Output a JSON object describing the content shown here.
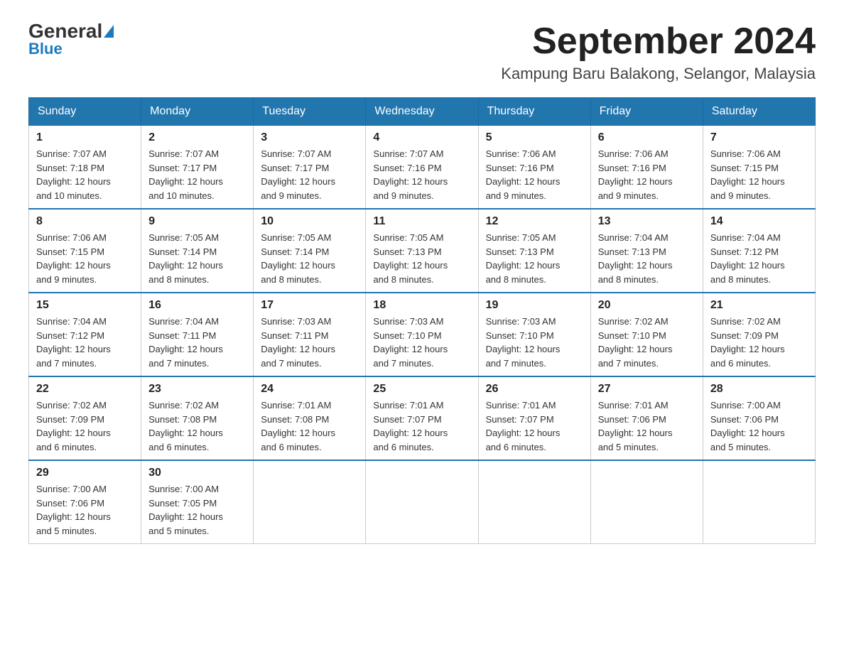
{
  "header": {
    "logo_general": "General",
    "logo_blue": "Blue",
    "month_title": "September 2024",
    "location": "Kampung Baru Balakong, Selangor, Malaysia"
  },
  "weekdays": [
    "Sunday",
    "Monday",
    "Tuesday",
    "Wednesday",
    "Thursday",
    "Friday",
    "Saturday"
  ],
  "weeks": [
    [
      {
        "day": "1",
        "sunrise": "7:07 AM",
        "sunset": "7:18 PM",
        "daylight": "12 hours and 10 minutes."
      },
      {
        "day": "2",
        "sunrise": "7:07 AM",
        "sunset": "7:17 PM",
        "daylight": "12 hours and 10 minutes."
      },
      {
        "day": "3",
        "sunrise": "7:07 AM",
        "sunset": "7:17 PM",
        "daylight": "12 hours and 9 minutes."
      },
      {
        "day": "4",
        "sunrise": "7:07 AM",
        "sunset": "7:16 PM",
        "daylight": "12 hours and 9 minutes."
      },
      {
        "day": "5",
        "sunrise": "7:06 AM",
        "sunset": "7:16 PM",
        "daylight": "12 hours and 9 minutes."
      },
      {
        "day": "6",
        "sunrise": "7:06 AM",
        "sunset": "7:16 PM",
        "daylight": "12 hours and 9 minutes."
      },
      {
        "day": "7",
        "sunrise": "7:06 AM",
        "sunset": "7:15 PM",
        "daylight": "12 hours and 9 minutes."
      }
    ],
    [
      {
        "day": "8",
        "sunrise": "7:06 AM",
        "sunset": "7:15 PM",
        "daylight": "12 hours and 9 minutes."
      },
      {
        "day": "9",
        "sunrise": "7:05 AM",
        "sunset": "7:14 PM",
        "daylight": "12 hours and 8 minutes."
      },
      {
        "day": "10",
        "sunrise": "7:05 AM",
        "sunset": "7:14 PM",
        "daylight": "12 hours and 8 minutes."
      },
      {
        "day": "11",
        "sunrise": "7:05 AM",
        "sunset": "7:13 PM",
        "daylight": "12 hours and 8 minutes."
      },
      {
        "day": "12",
        "sunrise": "7:05 AM",
        "sunset": "7:13 PM",
        "daylight": "12 hours and 8 minutes."
      },
      {
        "day": "13",
        "sunrise": "7:04 AM",
        "sunset": "7:13 PM",
        "daylight": "12 hours and 8 minutes."
      },
      {
        "day": "14",
        "sunrise": "7:04 AM",
        "sunset": "7:12 PM",
        "daylight": "12 hours and 8 minutes."
      }
    ],
    [
      {
        "day": "15",
        "sunrise": "7:04 AM",
        "sunset": "7:12 PM",
        "daylight": "12 hours and 7 minutes."
      },
      {
        "day": "16",
        "sunrise": "7:04 AM",
        "sunset": "7:11 PM",
        "daylight": "12 hours and 7 minutes."
      },
      {
        "day": "17",
        "sunrise": "7:03 AM",
        "sunset": "7:11 PM",
        "daylight": "12 hours and 7 minutes."
      },
      {
        "day": "18",
        "sunrise": "7:03 AM",
        "sunset": "7:10 PM",
        "daylight": "12 hours and 7 minutes."
      },
      {
        "day": "19",
        "sunrise": "7:03 AM",
        "sunset": "7:10 PM",
        "daylight": "12 hours and 7 minutes."
      },
      {
        "day": "20",
        "sunrise": "7:02 AM",
        "sunset": "7:10 PM",
        "daylight": "12 hours and 7 minutes."
      },
      {
        "day": "21",
        "sunrise": "7:02 AM",
        "sunset": "7:09 PM",
        "daylight": "12 hours and 6 minutes."
      }
    ],
    [
      {
        "day": "22",
        "sunrise": "7:02 AM",
        "sunset": "7:09 PM",
        "daylight": "12 hours and 6 minutes."
      },
      {
        "day": "23",
        "sunrise": "7:02 AM",
        "sunset": "7:08 PM",
        "daylight": "12 hours and 6 minutes."
      },
      {
        "day": "24",
        "sunrise": "7:01 AM",
        "sunset": "7:08 PM",
        "daylight": "12 hours and 6 minutes."
      },
      {
        "day": "25",
        "sunrise": "7:01 AM",
        "sunset": "7:07 PM",
        "daylight": "12 hours and 6 minutes."
      },
      {
        "day": "26",
        "sunrise": "7:01 AM",
        "sunset": "7:07 PM",
        "daylight": "12 hours and 6 minutes."
      },
      {
        "day": "27",
        "sunrise": "7:01 AM",
        "sunset": "7:06 PM",
        "daylight": "12 hours and 5 minutes."
      },
      {
        "day": "28",
        "sunrise": "7:00 AM",
        "sunset": "7:06 PM",
        "daylight": "12 hours and 5 minutes."
      }
    ],
    [
      {
        "day": "29",
        "sunrise": "7:00 AM",
        "sunset": "7:06 PM",
        "daylight": "12 hours and 5 minutes."
      },
      {
        "day": "30",
        "sunrise": "7:00 AM",
        "sunset": "7:05 PM",
        "daylight": "12 hours and 5 minutes."
      },
      null,
      null,
      null,
      null,
      null
    ]
  ],
  "labels": {
    "sunrise": "Sunrise:",
    "sunset": "Sunset:",
    "daylight": "Daylight:"
  }
}
